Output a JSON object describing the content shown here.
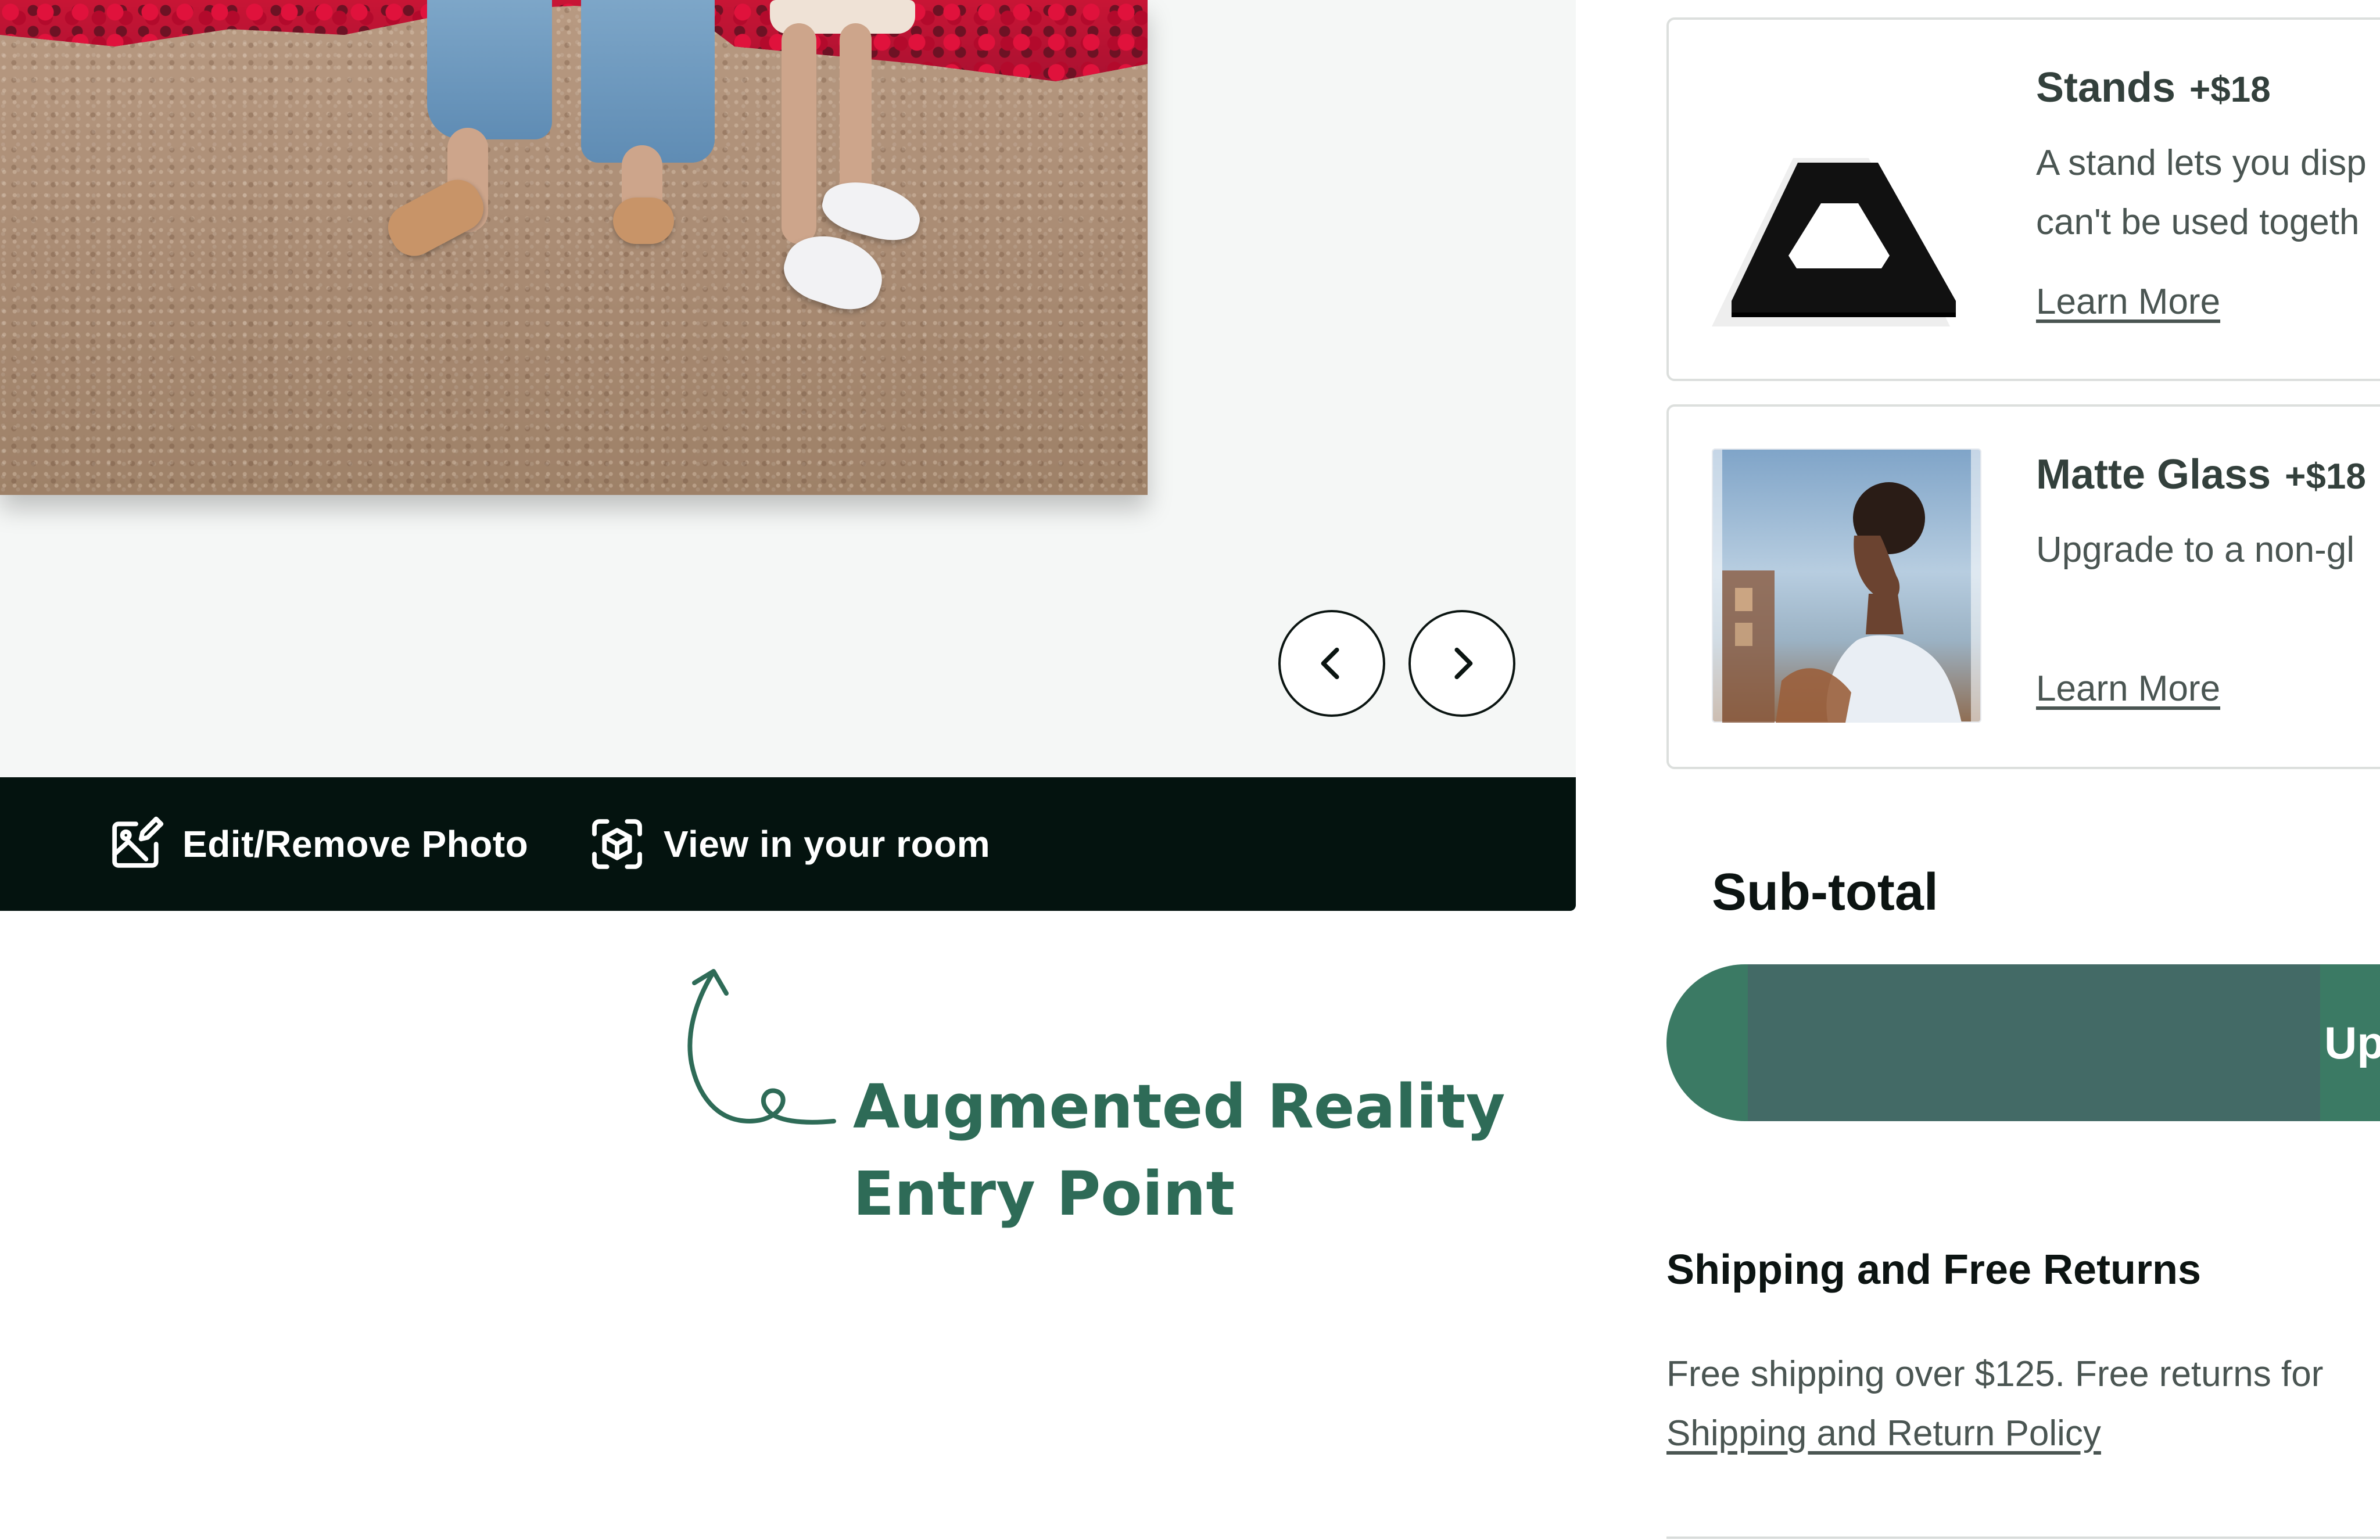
{
  "viewer": {
    "prev_label": "Previous",
    "next_label": "Next"
  },
  "toolbar": {
    "edit_label": "Edit/Remove Photo",
    "room_label": "View in your room"
  },
  "annotation": {
    "line1": "Augmented Reality",
    "line2": "Entry Point",
    "color": "#2e6b57"
  },
  "options": [
    {
      "title": "Stands",
      "price": "+$18",
      "description_lines": [
        "A stand lets you disp",
        "can't be used togeth"
      ],
      "link": "Learn More",
      "icon": "stand-icon"
    },
    {
      "title": "Matte Glass",
      "price": "+$18",
      "description_lines": [
        "Upgrade to a non-gl"
      ],
      "link": "Learn More",
      "icon": "matte-glass-photo"
    }
  ],
  "summary": {
    "subtotal_label": "Sub-total",
    "primary_button_label": "Up"
  },
  "shipping": {
    "title": "Shipping and Free Returns",
    "text": "Free shipping over $125. Free returns for",
    "link": "Shipping and Return Policy"
  },
  "colors": {
    "toolbar_bg": "#04130f",
    "accent": "#3b7a64",
    "button_mid": "#436a66"
  }
}
